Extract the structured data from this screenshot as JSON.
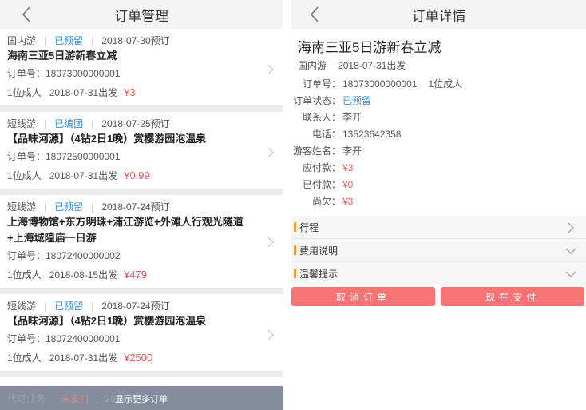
{
  "list_page": {
    "title": "订单管理",
    "orders": [
      {
        "category": "国内游",
        "status": "已预留",
        "booked": "2018-07-30预订",
        "name": "海南三亚5日游新春立减",
        "order_no": "订单号：18073000000001",
        "people": "1位成人",
        "depart": "2018-07-31出发",
        "price": "¥3"
      },
      {
        "category": "短线游",
        "status": "已编团",
        "booked": "2018-07-25预订",
        "name": "【品味河源】（4钻2日1晚）赏樱游园泡温泉",
        "order_no": "订单号：18072500000001",
        "people": "1位成人",
        "depart": "2018-07-31出发",
        "price": "¥0.99"
      },
      {
        "category": "短线游",
        "status": "已预留",
        "booked": "2018-07-24预订",
        "name": "上海博物馆+东方明珠+浦江游览+外滩人行观光隧道+上海城隍庙一日游",
        "order_no": "订单号：18072400000002",
        "people": "1位成人",
        "depart": "2018-08-15出发",
        "price": "¥479"
      },
      {
        "category": "短线游",
        "status": "已预留",
        "booked": "2018-07-24预订",
        "name": "【品味河源】（4钻2日1晚）赏樱游园泡温泉",
        "order_no": "订单号：18072400000001",
        "people": "1位成人",
        "depart": "2018-07-31出发",
        "price": "¥2500"
      }
    ],
    "partial_row": {
      "category": "代订业务",
      "status": "未支付",
      "booked": "2018"
    },
    "more_button": "显示更多订单"
  },
  "detail_page": {
    "title": "订单详情",
    "product_name": "海南三亚5日游新春立减",
    "category": "国内游",
    "depart": "2018-07-31出发",
    "rows": {
      "order_no_label": "订单号：",
      "order_no": "18073000000001",
      "people": "1位成人",
      "status_label": "订单状态：",
      "status": "已预留",
      "contact_label": "联系人：",
      "contact": "李开",
      "phone_label": "电话：",
      "phone": "13523642358",
      "guest_label": "游客姓名：",
      "guest": "李开",
      "payable_label": "应付款：",
      "payable": "¥3",
      "paid_label": "已付款：",
      "paid": "¥0",
      "owed_label": "尚欠：",
      "owed": "¥3"
    },
    "sections": [
      "行程",
      "费用说明",
      "温馨提示"
    ],
    "cancel_button": "取消订单",
    "pay_button": "现在支付"
  },
  "colors": {
    "accent_blue": "#3b8fd6",
    "price_red": "#f05c5c",
    "button_red": "#f77474",
    "section_mark": "#f0a030"
  }
}
